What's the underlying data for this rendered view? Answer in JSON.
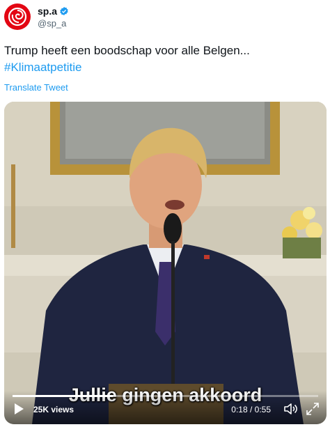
{
  "account": {
    "display_name": "sp.a",
    "handle": "@sp_a",
    "verified": true
  },
  "tweet": {
    "text": "Trump heeft een boodschap voor alle Belgen...",
    "hashtag": "#Klimaatpetitie",
    "translate_label": "Translate Tweet"
  },
  "video": {
    "subtitle": "Jullie gingen akkoord",
    "views": "25K views",
    "time": "0:18 / 0:55",
    "progress": 0.327
  },
  "colors": {
    "brand_red": "#e30613",
    "link_blue": "#1d9bf0"
  },
  "icons": [
    "sp-a-logo-icon",
    "verified-badge-icon",
    "play-icon",
    "volume-icon",
    "fullscreen-icon"
  ]
}
